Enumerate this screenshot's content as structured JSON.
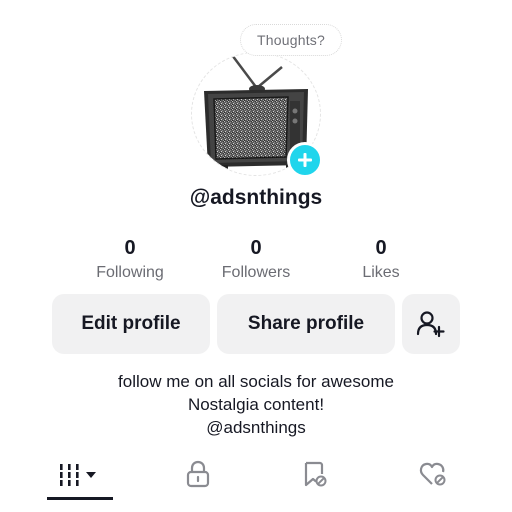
{
  "bubble": {
    "text": "Thoughts?"
  },
  "profile": {
    "username": "@adsnthings",
    "avatar_icon": "retro-tv-icon",
    "add_icon": "plus-icon",
    "accent_color": "#20d5ec"
  },
  "stats": [
    {
      "value": "0",
      "label": "Following"
    },
    {
      "value": "0",
      "label": "Followers"
    },
    {
      "value": "0",
      "label": "Likes"
    }
  ],
  "buttons": {
    "edit": "Edit profile",
    "share": "Share profile",
    "add_friend_icon": "add-friend-icon"
  },
  "bio": {
    "line1": "follow me on all socials for awesome",
    "line2": "Nostalgia content!",
    "line3": "@adsnthings"
  },
  "tabs": [
    {
      "icon": "grid-icon",
      "selected": true
    },
    {
      "icon": "lock-icon",
      "selected": false
    },
    {
      "icon": "bookmark-icon",
      "selected": false
    },
    {
      "icon": "liked-heart-icon",
      "selected": false
    }
  ]
}
